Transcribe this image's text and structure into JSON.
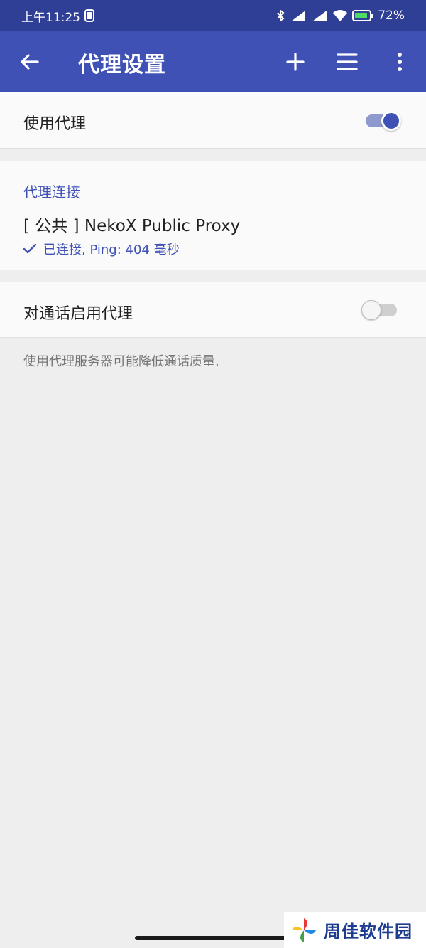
{
  "status_bar": {
    "time": "上午11:25",
    "battery": "72%"
  },
  "app_bar": {
    "title": "代理设置",
    "icons": [
      "back-arrow-icon",
      "add-icon",
      "menu-icon",
      "more-vert-icon"
    ]
  },
  "use_proxy": {
    "label": "使用代理",
    "enabled": true
  },
  "proxy_connection": {
    "header": "代理连接",
    "name": "[ 公共 ] NekoX Public Proxy",
    "status": "已连接, Ping: 404 毫秒"
  },
  "calls_proxy": {
    "label": "对通话启用代理",
    "enabled": false,
    "hint": "使用代理服务器可能降低通话质量."
  },
  "watermark": {
    "text": "周佳软件园"
  },
  "colors": {
    "primary": "#3f51b5",
    "status_bar": "#2f3f95",
    "background": "#eeeeee",
    "toggle_on_track": "#8e99cf",
    "toggle_on_thumb": "#3f51b5",
    "toggle_off_track": "#cfcfcf",
    "toggle_off_thumb": "#f5f5f5"
  }
}
